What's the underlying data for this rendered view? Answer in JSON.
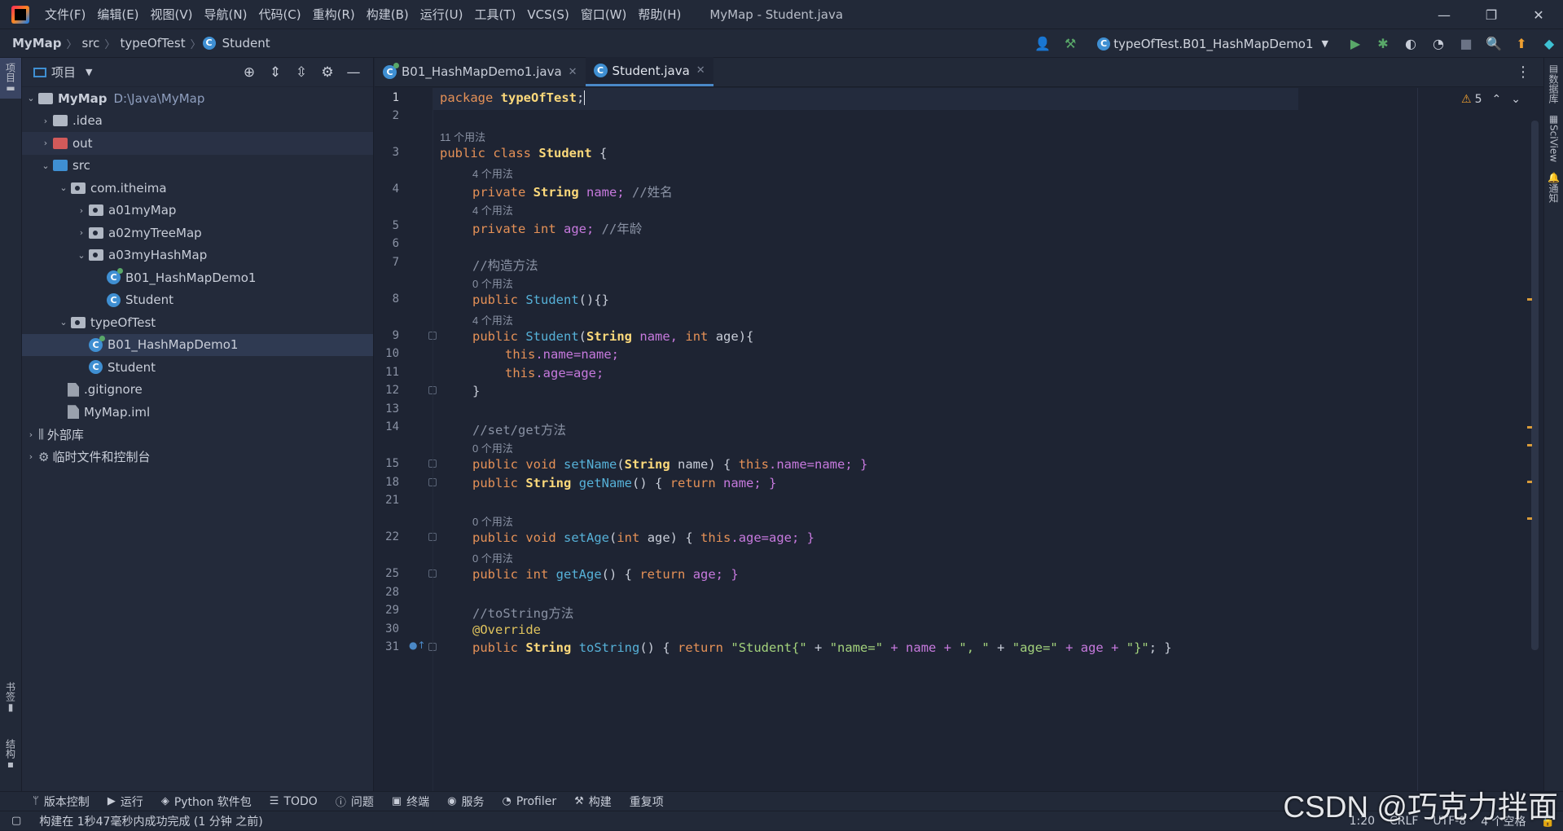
{
  "menubar": {
    "items": [
      "文件(F)",
      "编辑(E)",
      "视图(V)",
      "导航(N)",
      "代码(C)",
      "重构(R)",
      "构建(B)",
      "运行(U)",
      "工具(T)",
      "VCS(S)",
      "窗口(W)",
      "帮助(H)"
    ],
    "title": "MyMap - Student.java"
  },
  "breadcrumb": [
    "MyMap",
    "src",
    "typeOfTest",
    "Student"
  ],
  "toolbar": {
    "run_config": "typeOfTest.B01_HashMapDemo1"
  },
  "left_stripe": {
    "project": "项目",
    "bookmarks": "书签",
    "structure": "结构"
  },
  "right_stripe": {
    "database": "数据库",
    "sciview": "SciView",
    "notifications": "通知"
  },
  "project": {
    "title": "项目",
    "tree": [
      {
        "label": "MyMap",
        "path": "D:\\Java\\MyMap"
      },
      {
        "label": ".idea"
      },
      {
        "label": "out"
      },
      {
        "label": "src"
      },
      {
        "label": "com.itheima"
      },
      {
        "label": "a01myMap"
      },
      {
        "label": "a02myTreeMap"
      },
      {
        "label": "a03myHashMap"
      },
      {
        "label": "B01_HashMapDemo1"
      },
      {
        "label": "Student"
      },
      {
        "label": "typeOfTest"
      },
      {
        "label": "B01_HashMapDemo1"
      },
      {
        "label": "Student"
      },
      {
        "label": ".gitignore"
      },
      {
        "label": "MyMap.iml"
      },
      {
        "label": "外部库"
      },
      {
        "label": "临时文件和控制台"
      }
    ]
  },
  "tabs": [
    {
      "label": "B01_HashMapDemo1.java"
    },
    {
      "label": "Student.java"
    }
  ],
  "inspection": {
    "count": "5"
  },
  "code": {
    "line_numbers": [
      "1",
      "2",
      "3",
      "4",
      "5",
      "6",
      "7",
      "8",
      "9",
      "10",
      "11",
      "12",
      "13",
      "14",
      "15",
      "18",
      "21",
      "22",
      "25",
      "28",
      "29",
      "30",
      "31"
    ],
    "hints": [
      "11 个用法",
      "4 个用法",
      "4 个用法",
      "0 个用法",
      "4 个用法",
      "0 个用法",
      "0 个用法",
      "0 个用法"
    ],
    "l1_kw": "package",
    "l1_pkg": "typeOfTest",
    "l3_kw": "public class",
    "l3_cls": "Student",
    "l3_rest": "{",
    "l4_kw": "private",
    "l4_type": "String",
    "l4_rest": "name;",
    "l4_cmt": "//姓名",
    "l5_kw": "private int",
    "l5_rest": "age;",
    "l5_cmt": "//年龄",
    "l7_cmt": "//构造方法",
    "l8_kw": "public",
    "l8_meth": "Student",
    "l8_rest": "(){}",
    "l9_kw": "public",
    "l9_meth": "Student",
    "l9_a": "(",
    "l9_type": "String",
    "l9_b": "name,",
    "l9_kw2": "int",
    "l9_c": "age){",
    "l10_kw": "this",
    "l10_rest": ".name=name;",
    "l11_kw": "this",
    "l11_rest": ".age=age;",
    "l12": "}",
    "l14_cmt": "//set/get方法",
    "l15_kw": "public void",
    "l15_meth": "setName",
    "l15_a": "(",
    "l15_type": "String",
    "l15_b": "name) {",
    "l15_kw2": "this",
    "l15_c": ".name=name; }",
    "l18_kw": "public",
    "l18_type": "String",
    "l18_meth": "getName",
    "l18_a": "() {",
    "l18_kw2": "return",
    "l18_b": "name; }",
    "l22_kw": "public void",
    "l22_meth": "setAge",
    "l22_a": "(",
    "l22_kw2": "int",
    "l22_b": "age) {",
    "l22_kw3": "this",
    "l22_c": ".age=age; }",
    "l25_kw": "public int",
    "l25_meth": "getAge",
    "l25_a": "() {",
    "l25_kw2": "return",
    "l25_b": "age; }",
    "l29_cmt": "//toString方法",
    "l30_ann": "@Override",
    "l31_kw": "public",
    "l31_type": "String",
    "l31_meth": "toString",
    "l31_a": "() {",
    "l31_kw2": "return",
    "l31_s1": "\"Student{\"",
    "l31_p1": "+",
    "l31_s2": "\"name=\"",
    "l31_p2": "+ name +",
    "l31_s3": "\", \"",
    "l31_p3": "+",
    "l31_s4": "\"age=\"",
    "l31_p4": "+ age +",
    "l31_s5": "\"}\"",
    "l31_end": "; }"
  },
  "toolwindows": [
    "版本控制",
    "运行",
    "Python 软件包",
    "TODO",
    "问题",
    "终端",
    "服务",
    "Profiler",
    "构建",
    "重复项"
  ],
  "status": {
    "message": "构建在 1秒47毫秒内成功完成 (1 分钟 之前)",
    "position": "1:20",
    "line_sep": "CRLF",
    "encoding": "UTF-8",
    "indent": "4 个空格"
  },
  "watermark": "CSDN @巧克力拌面"
}
